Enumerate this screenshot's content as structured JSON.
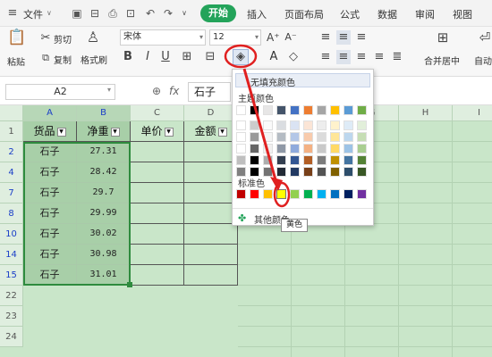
{
  "menubar": {
    "file_label": "文件",
    "tabs": [
      "开始",
      "插入",
      "页面布局",
      "公式",
      "数据",
      "审阅",
      "视图"
    ],
    "active_tab": "开始",
    "accent": "#23a35a"
  },
  "ribbon": {
    "paste_label": "粘贴",
    "cut_label": "剪切",
    "copy_label": "复制",
    "format_painter_label": "格式刷",
    "font_name": "宋体",
    "font_size": "12",
    "bold": "B",
    "italic": "I",
    "underline": "U",
    "merge_center_label": "合并居中",
    "auto_wrap_label": "自动"
  },
  "formula_bar": {
    "name_box": "A2",
    "fx": "fx",
    "formula_value": "石子"
  },
  "sheet": {
    "columns": [
      "A",
      "B",
      "C",
      "D",
      "E",
      "F",
      "G",
      "H",
      "I"
    ],
    "header_row": {
      "row_num": "1",
      "cells": [
        "货品",
        "净重",
        "单价",
        "金额"
      ]
    },
    "rows": [
      {
        "num": "2",
        "product": "石子",
        "weight": "27.31"
      },
      {
        "num": "4",
        "product": "石子",
        "weight": "28.42"
      },
      {
        "num": "7",
        "product": "石子",
        "weight": "29.7"
      },
      {
        "num": "8",
        "product": "石子",
        "weight": "29.99"
      },
      {
        "num": "10",
        "product": "石子",
        "weight": "30.02"
      },
      {
        "num": "14",
        "product": "石子",
        "weight": "30.98"
      },
      {
        "num": "15",
        "product": "石子",
        "weight": "31.01"
      }
    ],
    "blank_rows": [
      "22",
      "23",
      "24"
    ],
    "sheet_color": "#c9e6c9",
    "selected_color": "#a8cfa8"
  },
  "palette": {
    "no_fill_label": "无填充颜色",
    "theme_label": "主题颜色",
    "standard_label": "标准色",
    "more_colors_label": "其他颜色",
    "theme_colors": [
      "#ffffff",
      "#000000",
      "#e7e6e6",
      "#44546a",
      "#4472c4",
      "#ed7d31",
      "#a5a5a5",
      "#ffc000",
      "#5b9bd5",
      "#70ad47"
    ],
    "standard_colors": [
      "#c00000",
      "#ff0000",
      "#ffc000",
      "#ffff00",
      "#92d050",
      "#00b050",
      "#00b0f0",
      "#0070c0",
      "#002060",
      "#7030a0"
    ],
    "highlighted_index": 3,
    "tooltip": "黄色"
  },
  "annotation_color": "#e02020"
}
